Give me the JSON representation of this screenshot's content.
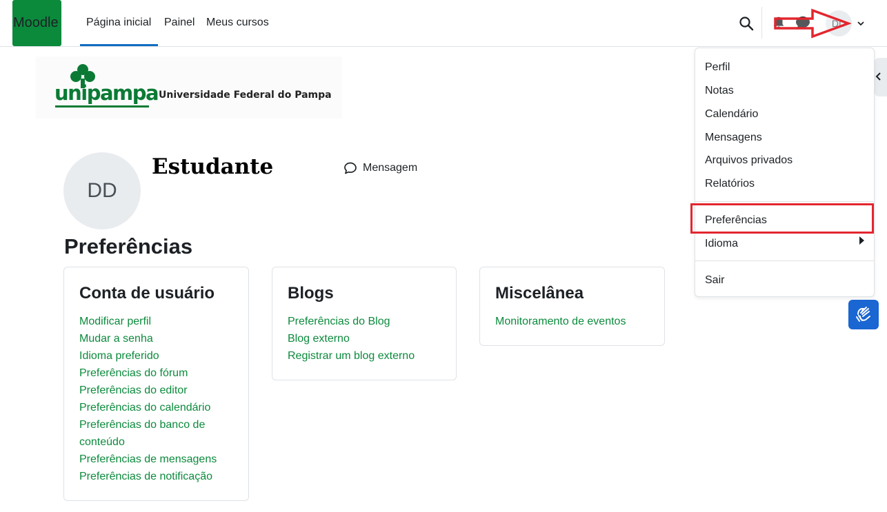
{
  "navbar": {
    "brand": "Moodle",
    "links": [
      "Página inicial",
      "Painel",
      "Meus cursos"
    ],
    "avatar_initials": "DD",
    "active_color": "#0f6cbf",
    "brand_color": "#0b8a3c"
  },
  "logo": {
    "wordmark": "unipampa",
    "subtitle": "Universidade Federal do Pampa"
  },
  "profile": {
    "initials": "DD",
    "name": "Estudante",
    "message_label": "Mensagem"
  },
  "page": {
    "title": "Preferências"
  },
  "cards": [
    {
      "title": "Conta de usuário",
      "links": [
        "Modificar perfil",
        "Mudar a senha",
        "Idioma preferido",
        "Preferências do fórum",
        "Preferências do editor",
        "Preferências do calendário",
        "Preferências do banco de conteúdo",
        "Preferências de mensagens",
        "Preferências de notificação"
      ]
    },
    {
      "title": "Blogs",
      "links": [
        "Preferências do Blog",
        "Blog externo",
        "Registrar um blog externo"
      ]
    },
    {
      "title": "Miscelânea",
      "links": [
        "Monitoramento de eventos"
      ]
    }
  ],
  "dropdown": {
    "items": [
      "Perfil",
      "Notas",
      "Calendário",
      "Mensagens",
      "Arquivos privados",
      "Relatórios",
      "Preferências",
      "Idioma",
      "Sair"
    ]
  },
  "icons": {
    "search": "search-icon",
    "notifications": "bell-icon",
    "messages": "chat-icon",
    "user_menu": "chevron-down-icon",
    "drawer": "chevron-left-icon",
    "accessibility": "sign-language-icon"
  },
  "annotation_color": "#e3262f"
}
